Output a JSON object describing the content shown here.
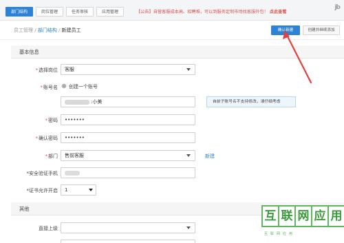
{
  "tabs": [
    {
      "label": "部门结构",
      "active": true
    },
    {
      "label": "岗位管理",
      "active": false
    },
    {
      "label": "任务审核",
      "active": false
    },
    {
      "label": "应用管理",
      "active": false
    }
  ],
  "announcement": {
    "text": "【公告】自营客服成本高、招聘难，可以到服务定制市场找客服外包！",
    "link": "点此查看"
  },
  "corner_logo": "jb",
  "breadcrumb": {
    "root": "员工管理",
    "sep": "/",
    "parent": "部门结构",
    "current": "新建员工"
  },
  "actions": {
    "confirm": "确认新建",
    "continue": "创建并继续添加"
  },
  "sections": {
    "basic": "基本信息",
    "other": "其他"
  },
  "form": {
    "post": {
      "label": "选择岗位",
      "value": "客服"
    },
    "account": {
      "label": "账号名",
      "radio_label": "创建一个账号",
      "value_suffix": ":小美",
      "tip": "自前子账号名不支持修改，请仔细考虑"
    },
    "password": {
      "label": "密码",
      "value": "•••••••"
    },
    "confirm_password": {
      "label": "确认密码",
      "value": "•••••••"
    },
    "department": {
      "label": "部门",
      "value": "售前客服",
      "add_link": "新建"
    },
    "phone": {
      "label": "*安全验证手机"
    },
    "cert": {
      "label": "*证书允许开启",
      "value": "1"
    },
    "superior": {
      "label": "直接上级",
      "value": ""
    }
  },
  "watermark": {
    "chars": [
      "互",
      "联",
      "网",
      "应",
      "用"
    ],
    "sub": "互联网应用"
  },
  "colors": {
    "primary": "#2d82d4",
    "required": "#d9534f",
    "arrow": "#e2403a",
    "watermark": "#5cb85c"
  }
}
